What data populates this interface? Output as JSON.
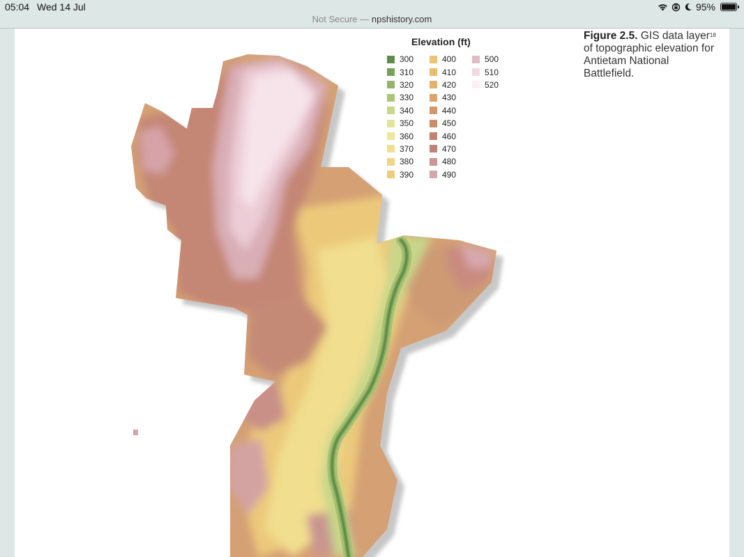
{
  "status_bar": {
    "time": "05:04",
    "date": "Wed 14 Jul",
    "battery": "95%",
    "icons": [
      "wifi-icon",
      "orientation-lock-icon",
      "moon-icon",
      "battery-icon"
    ]
  },
  "browser": {
    "security_label": "Not Secure —",
    "domain": "npshistory.com"
  },
  "figure": {
    "label": "Figure 2.5.",
    "text_before_ref": "GIS data layer",
    "footnote_ref": "18",
    "text_after_ref": "of topographic elevation for Antietam National Battlefield."
  },
  "legend": {
    "title": "Elevation (ft)",
    "columns": [
      [
        {
          "value": "300",
          "color": "#5e8c4c"
        },
        {
          "value": "310",
          "color": "#77a05a"
        },
        {
          "value": "320",
          "color": "#92b469"
        },
        {
          "value": "330",
          "color": "#aac675"
        },
        {
          "value": "340",
          "color": "#c6d88a"
        },
        {
          "value": "350",
          "color": "#e0e496"
        },
        {
          "value": "360",
          "color": "#eee79b"
        },
        {
          "value": "370",
          "color": "#f1df8f"
        },
        {
          "value": "380",
          "color": "#f0d585"
        },
        {
          "value": "390",
          "color": "#eccb7c"
        }
      ],
      [
        {
          "value": "400",
          "color": "#ecc477"
        },
        {
          "value": "410",
          "color": "#e9bc72"
        },
        {
          "value": "420",
          "color": "#e2b170"
        },
        {
          "value": "430",
          "color": "#d9a46e"
        },
        {
          "value": "440",
          "color": "#d1996d"
        },
        {
          "value": "450",
          "color": "#c98e6c"
        },
        {
          "value": "460",
          "color": "#bf8370"
        },
        {
          "value": "470",
          "color": "#c08377"
        },
        {
          "value": "480",
          "color": "#cc9692"
        },
        {
          "value": "490",
          "color": "#d4a7aa"
        }
      ],
      [
        {
          "value": "500",
          "color": "#e0bcc6"
        },
        {
          "value": "510",
          "color": "#f2d9e2"
        },
        {
          "value": "520",
          "color": "#fcf0f3"
        }
      ]
    ]
  }
}
